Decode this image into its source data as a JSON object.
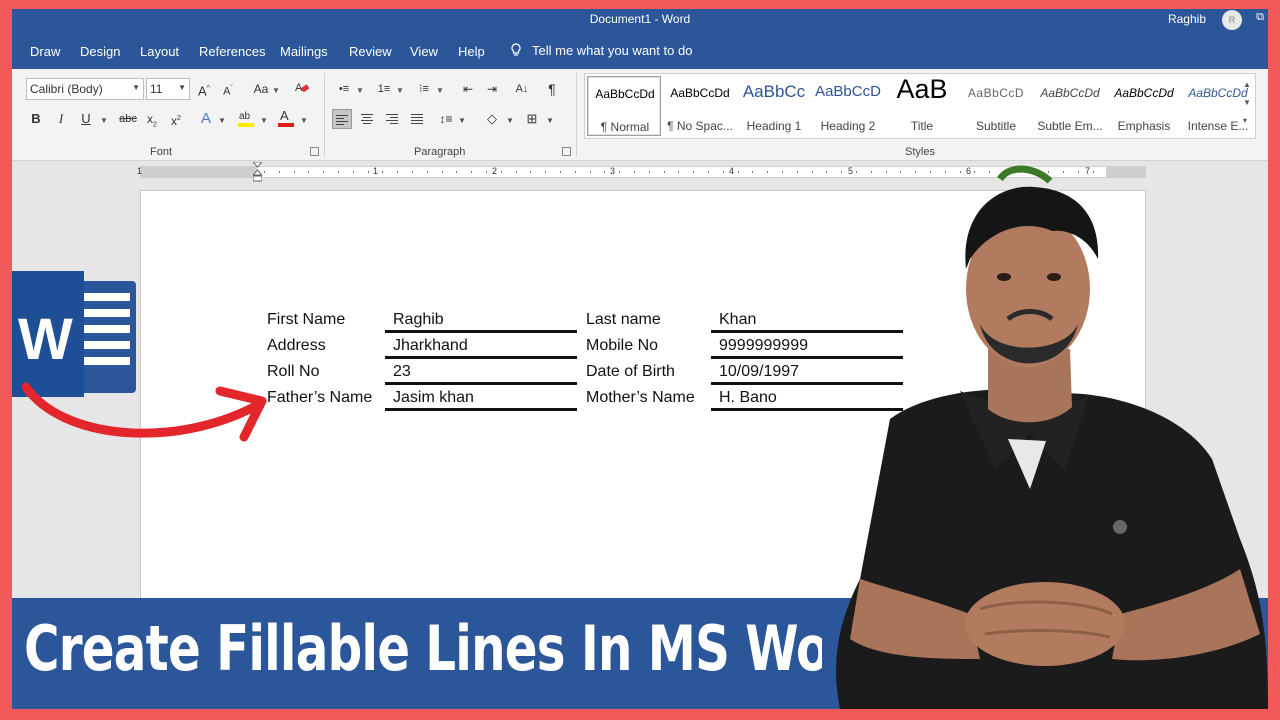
{
  "window": {
    "title": "Document1  -  Word",
    "user": "Raghib",
    "avatar_initial": "R"
  },
  "tabs": [
    "Draw",
    "Design",
    "Layout",
    "References",
    "Mailings",
    "Review",
    "View",
    "Help"
  ],
  "tell_me": "Tell me what you want to do",
  "font": {
    "name": "Calibri (Body)",
    "size": "11",
    "group_label": "Font"
  },
  "paragraph": {
    "group_label": "Paragraph"
  },
  "styles": {
    "group_label": "Styles",
    "items": [
      {
        "preview": "AaBbCcDd",
        "name": "¶ Normal"
      },
      {
        "preview": "AaBbCcDd",
        "name": "¶ No Spac..."
      },
      {
        "preview": "AaBbCc",
        "name": "Heading 1"
      },
      {
        "preview": "AaBbCcD",
        "name": "Heading 2"
      },
      {
        "preview": "AaB",
        "name": "Title"
      },
      {
        "preview": "AaBbCcD",
        "name": "Subtitle"
      },
      {
        "preview": "AaBbCcDd",
        "name": "Subtle Em..."
      },
      {
        "preview": "AaBbCcDd",
        "name": "Emphasis"
      },
      {
        "preview": "AaBbCcDd",
        "name": "Intense E..."
      }
    ]
  },
  "ruler": {
    "numbers": [
      "1",
      "1",
      "2",
      "3",
      "4",
      "5",
      "6",
      "7"
    ]
  },
  "form": [
    {
      "label1": "First Name",
      "value1": "Raghib",
      "label2": "Last name",
      "value2": "Khan"
    },
    {
      "label1": "Address",
      "value1": "Jharkhand",
      "label2": "Mobile No",
      "value2": "9999999999"
    },
    {
      "label1": "Roll No",
      "value1": "23",
      "label2": "Date of Birth",
      "value2": "10/09/1997"
    },
    {
      "label1": "Father’s Name",
      "value1": "Jasim khan",
      "label2": "Mother’s Name",
      "value2": "H. Bano"
    }
  ],
  "logo_letter": "W",
  "banner": {
    "text": "Create Fillable Lines In MS Word"
  },
  "colors": {
    "word_blue": "#2b579a",
    "frame_red": "#f25a5a",
    "arrow_red": "#e3262b"
  }
}
